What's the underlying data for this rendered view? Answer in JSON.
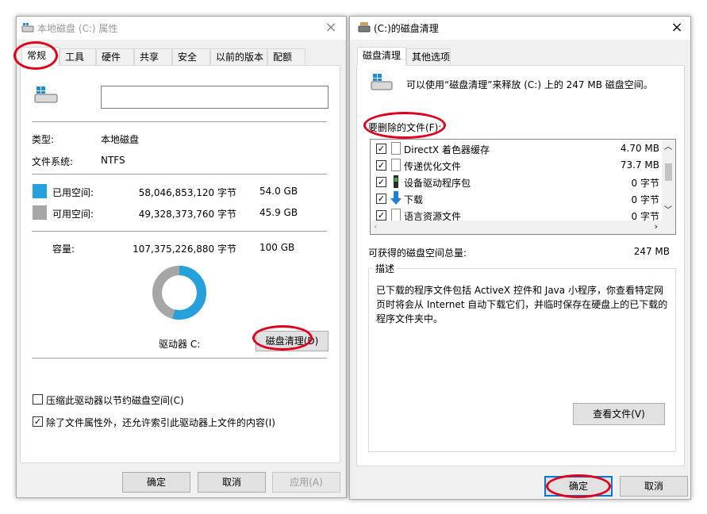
{
  "left_window": {
    "title": "本地磁盘 (C:) 属性",
    "tabs": [
      "常规",
      "工具",
      "硬件",
      "共享",
      "安全",
      "以前的版本",
      "配额"
    ],
    "name_field_value": "",
    "type_label": "类型:",
    "type_value": "本地磁盘",
    "fs_label": "文件系统:",
    "fs_value": "NTFS",
    "used": {
      "label": "已用空间:",
      "bytes": "58,046,853,120 字节",
      "size": "54.0 GB",
      "color": "#26a0da"
    },
    "free": {
      "label": "可用空间:",
      "bytes": "49,328,373,760 字节",
      "size": "45.9 GB",
      "color": "#a6a6a6"
    },
    "capacity": {
      "label": "容量:",
      "bytes": "107,375,226,880 字节",
      "size": "100 GB"
    },
    "used_fraction": 0.54,
    "drive_label": "驱动器 C:",
    "cleanup_button": "磁盘清理(D)",
    "compress_label": "压缩此驱动器以节约磁盘空间(C)",
    "compress_checked": false,
    "index_label": "除了文件属性外，还允许索引此驱动器上文件的内容(I)",
    "index_checked": true,
    "buttons": {
      "ok": "确定",
      "cancel": "取消",
      "apply": "应用(A)"
    }
  },
  "right_window": {
    "title": "(C:)的磁盘清理",
    "tabs": [
      "磁盘清理",
      "其他选项"
    ],
    "intro": "可以使用“磁盘清理”来释放  (C:) 上的 247 MB 磁盘空间。",
    "files_label": "要删除的文件(F):",
    "files": [
      {
        "name": "DirectX 着色器缓存",
        "size": "4.70 MB",
        "checked": true,
        "icon": "file-icon"
      },
      {
        "name": "传递优化文件",
        "size": "73.7 MB",
        "checked": true,
        "icon": "file-icon"
      },
      {
        "name": "设备驱动程序包",
        "size": "0 字节",
        "checked": true,
        "icon": "driver-package-icon"
      },
      {
        "name": "下载",
        "size": "0 字节",
        "checked": true,
        "icon": "download-arrow-icon"
      },
      {
        "name": "语言资源文件",
        "size": "0 字节",
        "checked": true,
        "icon": "file-icon"
      }
    ],
    "total_label": "可获得的磁盘空间总量:",
    "total_value": "247 MB",
    "description_title": "描述",
    "description": "已下载的程序文件包括 ActiveX 控件和 Java 小程序，你查看特定网页时将会从 Internet 自动下载它们，并临时保存在硬盘上的已下载的程序文件夹中。",
    "view_files_button": "查看文件(V)",
    "buttons": {
      "ok": "确定",
      "cancel": "取消"
    }
  }
}
